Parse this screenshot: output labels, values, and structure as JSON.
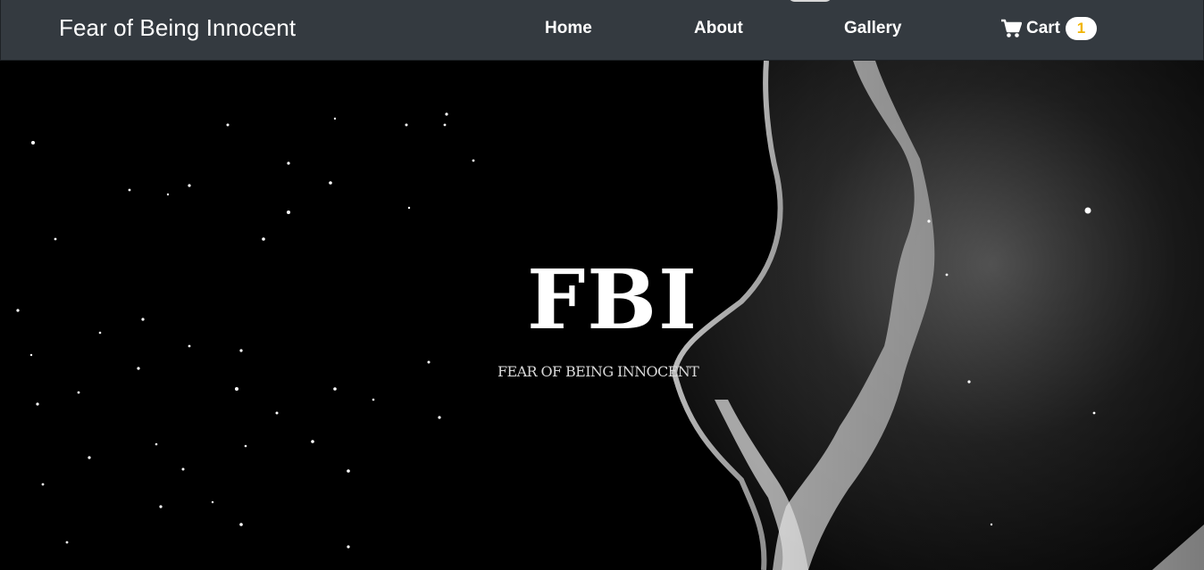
{
  "navbar": {
    "brand": "Fear of Being Innocent",
    "links": {
      "home": "Home",
      "about": "About",
      "gallery": "Gallery",
      "cart": "Cart"
    },
    "cart_count": "1",
    "cart_icon": "shopping-cart-icon"
  },
  "hero": {
    "title": "FBI",
    "subtitle": "FEAR OF BEING INNOCENT"
  },
  "colors": {
    "navbar_bg": "#343a40",
    "badge_bg": "#ffffff",
    "badge_text": "#f0b400",
    "hero_bg": "#000000"
  }
}
